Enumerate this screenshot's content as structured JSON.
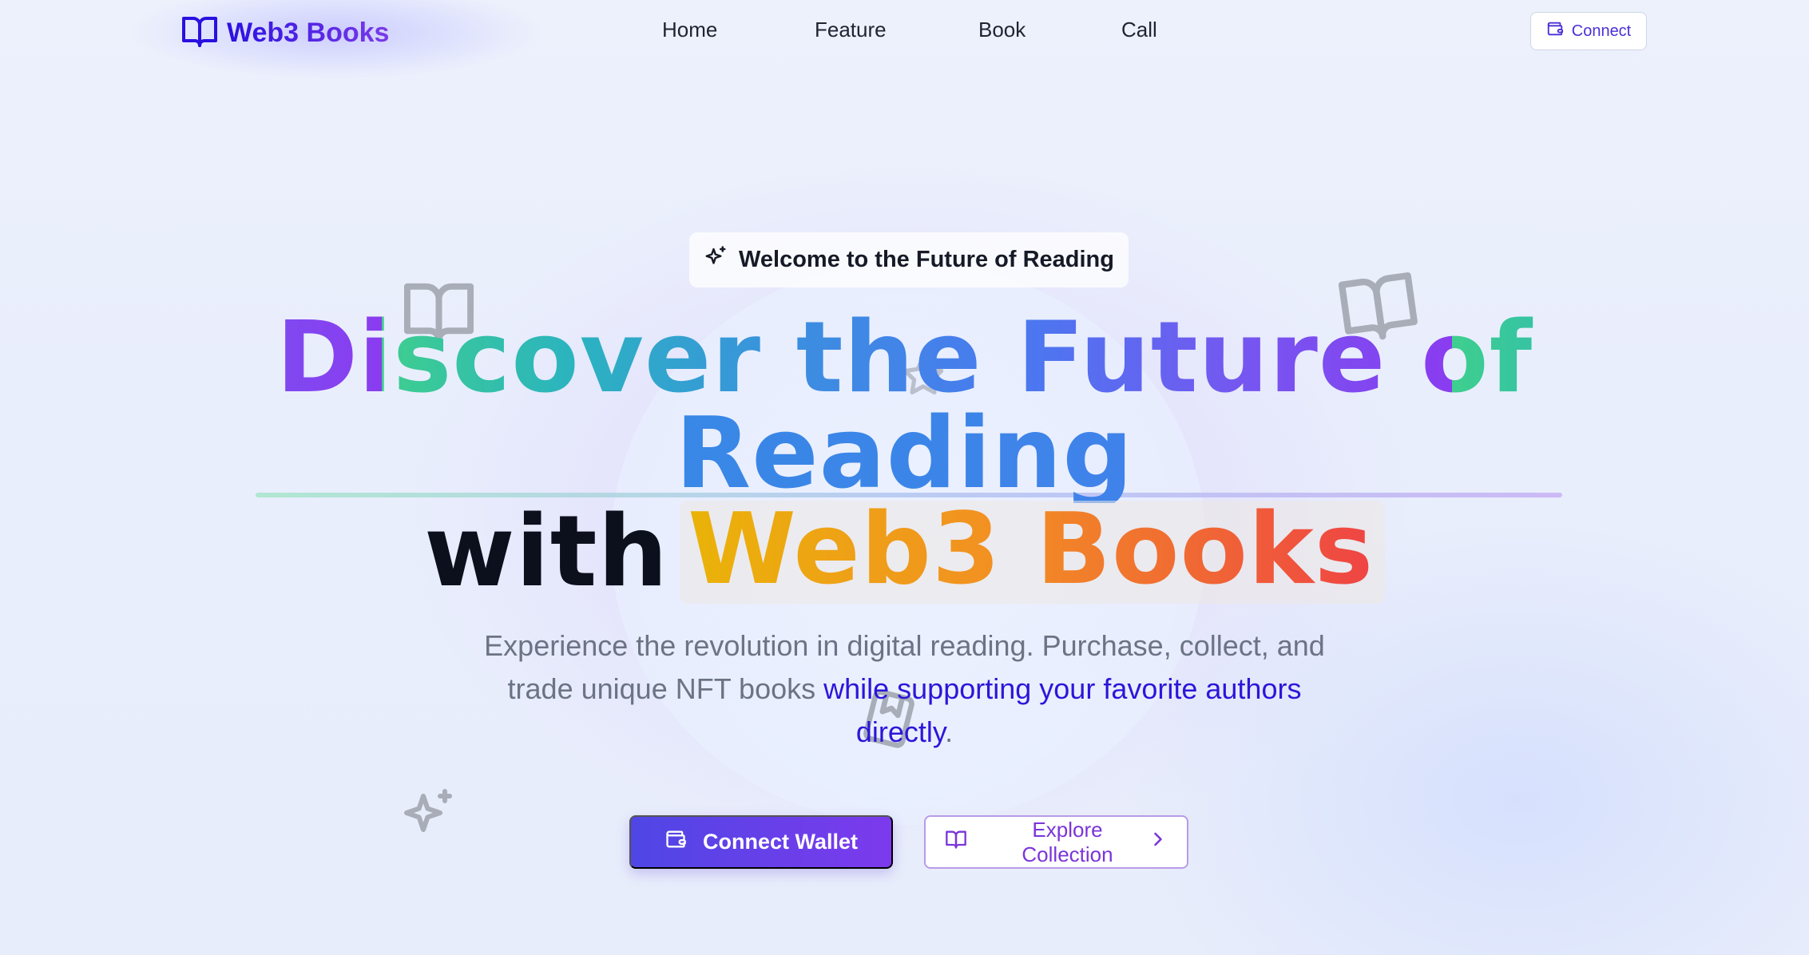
{
  "nav": {
    "logo_text": "Web3 Books",
    "links": [
      "Home",
      "Feature",
      "Book",
      "Call"
    ],
    "connect_label": "Connect"
  },
  "hero": {
    "badge": "Welcome to the Future of Reading",
    "headline_line1": "Discover the Future of",
    "headline_line2": "Reading",
    "headline_with": "with",
    "headline_brand": "Web3 Books",
    "subtitle_plain": "Experience the revolution in digital reading. Purchase, collect, and trade unique NFT books",
    "subtitle_highlight": "while supporting your favorite authors directly",
    "subtitle_end": ".",
    "primary_button": "Connect Wallet",
    "secondary_button": "Explore Collection"
  },
  "icons": {
    "logo": "open-book-icon",
    "connect": "wallet-icon",
    "badge": "sparkles-icon",
    "primary_button": "wallet-icon",
    "secondary_button": "open-book-icon",
    "secondary_chevron": "chevron-right-icon"
  },
  "colors": {
    "brand_indigo": "#4f46e5",
    "brand_violet": "#7c3aed",
    "highlight_text": "#2c16d9"
  }
}
